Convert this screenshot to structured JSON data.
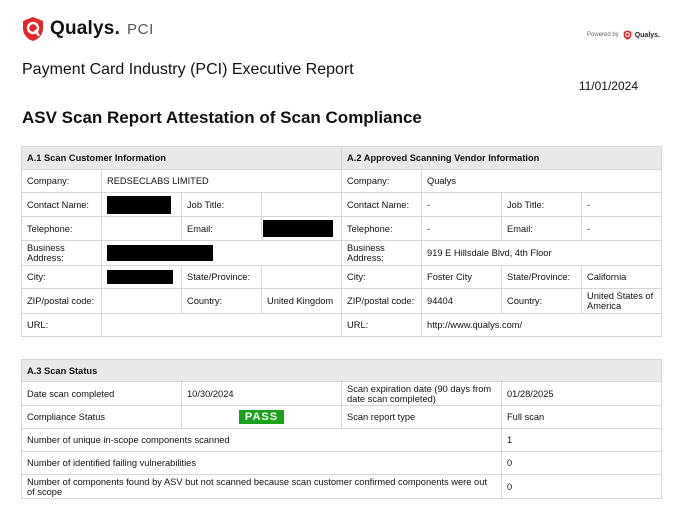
{
  "brand": {
    "name": "Qualys.",
    "suffix": "PCI",
    "powered_by": "Powered by",
    "powered_brand": "Qualys."
  },
  "report_title": "Payment Card Industry (PCI) Executive Report",
  "report_date": "11/01/2024",
  "doc_title": "ASV Scan Report Attestation of Scan Compliance",
  "a1": {
    "heading": "A.1 Scan Customer Information",
    "company_label": "Company:",
    "company": "REDSECLABS LIMITED",
    "contact_label": "Contact Name:",
    "job_title_label": "Job Title:",
    "telephone_label": "Telephone:",
    "email_label": "Email:",
    "address_label": "Business Address:",
    "city_label": "City:",
    "state_label": "State/Province:",
    "zip_label": "ZIP/postal code:",
    "country_label": "Country:",
    "country": "United Kingdom",
    "url_label": "URL:"
  },
  "a2": {
    "heading": "A.2 Approved Scanning Vendor Information",
    "company_label": "Company:",
    "company": "Qualys",
    "contact_label": "Contact Name:",
    "contact": "-",
    "job_title_label": "Job Title:",
    "job_title": "-",
    "telephone_label": "Telephone:",
    "telephone": "-",
    "email_label": "Email:",
    "email": "-",
    "address_label": "Business Address:",
    "address": "919 E Hillsdale Blvd, 4th Floor",
    "city_label": "City:",
    "city": "Foster City",
    "state_label": "State/Province:",
    "state": "California",
    "zip_label": "ZIP/postal code:",
    "zip": "94404",
    "country_label": "Country:",
    "country": "United States of America",
    "url_label": "URL:",
    "url": "http://www.qualys.com/"
  },
  "a3": {
    "heading": "A.3 Scan Status",
    "date_completed_label": "Date scan completed",
    "date_completed": "10/30/2024",
    "expiration_label": "Scan expiration date (90 days from date scan completed)",
    "expiration": "01/28/2025",
    "compliance_label": "Compliance Status",
    "compliance": "PASS",
    "report_type_label": "Scan report type",
    "report_type": "Full scan",
    "components_label": "Number of unique in-scope components scanned",
    "components": "1",
    "failing_label": "Number of identified failing vulnerabilities",
    "failing": "0",
    "not_scanned_label": "Number of components found by ASV but not scanned because scan customer confirmed components were out of scope",
    "not_scanned": "0"
  },
  "colors": {
    "brand_red": "#e3262b",
    "pass_green": "#1ca11c",
    "section_bg": "#e9e9e9"
  }
}
